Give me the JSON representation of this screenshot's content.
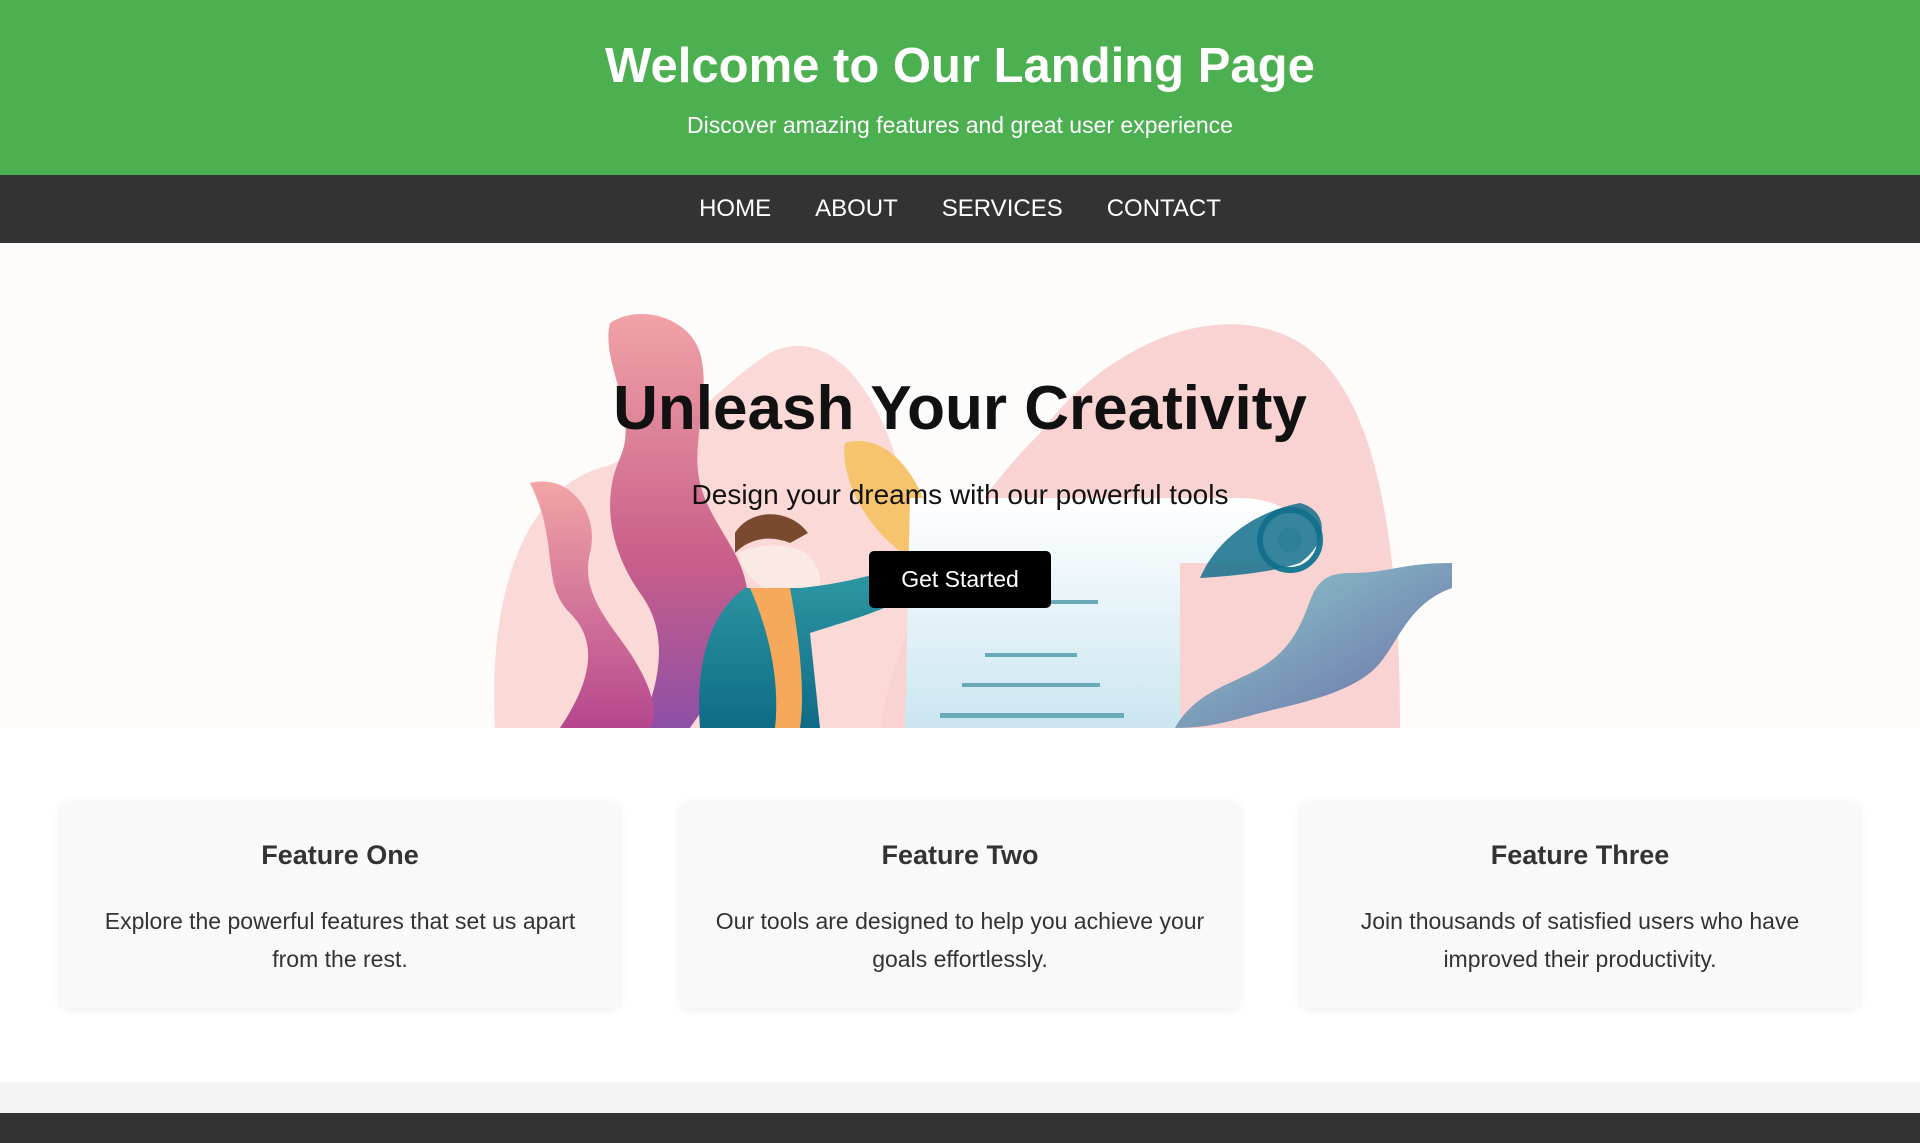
{
  "header": {
    "title": "Welcome to Our Landing Page",
    "subtitle": "Discover amazing features and great user experience"
  },
  "nav": {
    "items": [
      {
        "label": "HOME"
      },
      {
        "label": "ABOUT"
      },
      {
        "label": "SERVICES"
      },
      {
        "label": "CONTACT"
      }
    ]
  },
  "hero": {
    "title": "Unleash Your Creativity",
    "subtitle": "Design your dreams with our powerful tools",
    "cta_label": "Get Started",
    "illustration": "person-with-document-illustration"
  },
  "features": [
    {
      "title": "Feature One",
      "text": "Explore the powerful features that set us apart from the rest."
    },
    {
      "title": "Feature Two",
      "text": "Our tools are designed to help you achieve your goals effortlessly."
    },
    {
      "title": "Feature Three",
      "text": "Join thousands of satisfied users who have improved their productivity."
    }
  ],
  "colors": {
    "header_bg": "#4caf50",
    "nav_bg": "#333333",
    "cta_bg": "#000000",
    "footer_bg": "#333333"
  }
}
